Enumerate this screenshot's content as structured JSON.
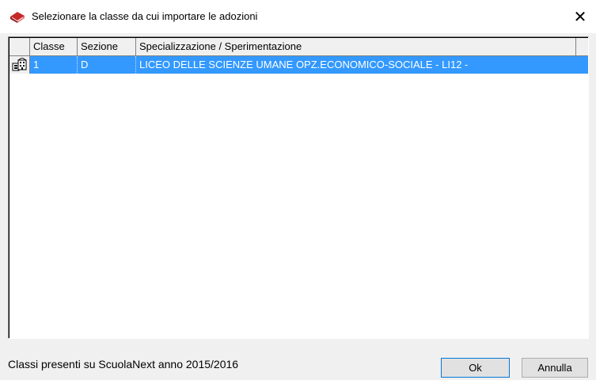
{
  "window": {
    "title": "Selezionare la classe da cui importare le adozioni",
    "icon": "book-icon",
    "close_label": "✕"
  },
  "grid": {
    "columns": [
      "Classe",
      "Sezione",
      "Specializzazione / Sperimentazione"
    ],
    "rows": [
      {
        "icon": "class-group-icon",
        "classe": "1",
        "sezione": "D",
        "specializzazione": "LICEO DELLE SCIENZE UMANE OPZ.ECONOMICO-SOCIALE - LI12 -",
        "selected": true
      }
    ]
  },
  "footer": {
    "status": "Classi presenti su ScuolaNext anno 2015/2016",
    "ok_label": "Ok",
    "cancel_label": "Annulla"
  },
  "colors": {
    "selection": "#3399ff",
    "window_bg": "#f0f0f0",
    "title_icon": "#d32f2f"
  }
}
